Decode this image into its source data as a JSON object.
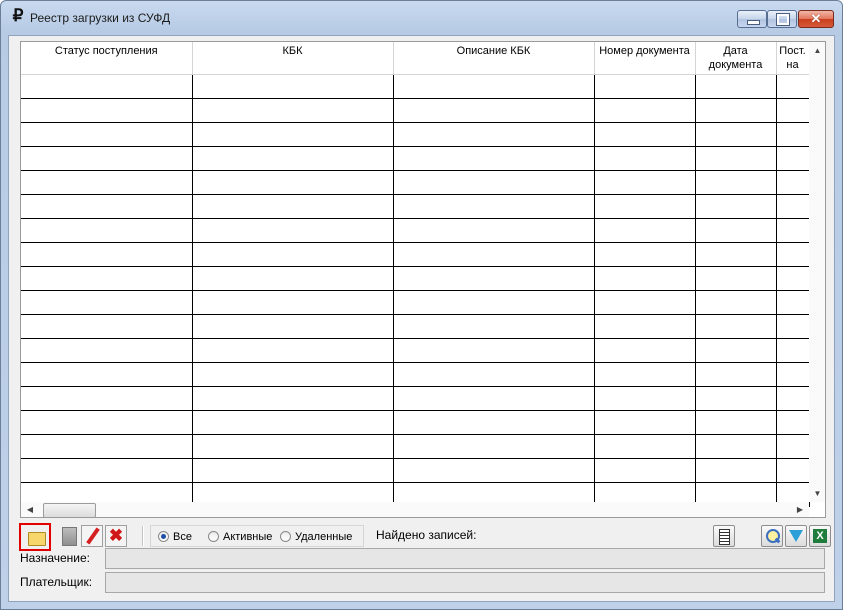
{
  "window": {
    "title": "Реестр загрузки из СУФД",
    "icon": "ruble-icon",
    "icon_glyph": "₽",
    "buttons": {
      "minimize": "minimize-icon",
      "maximize": "maximize-icon",
      "close_glyph": "✕"
    }
  },
  "grid": {
    "columns": [
      {
        "label": "Статус поступления"
      },
      {
        "label": "КБК"
      },
      {
        "label": "Описание КБК"
      },
      {
        "label": "Номер документа"
      },
      {
        "label": "Дата документа"
      },
      {
        "label": "Пост. на"
      }
    ],
    "row_count": 18
  },
  "toolbar": {
    "open_icon": "folder-open-icon",
    "stop_icon": "stop-icon",
    "edit_icon": "pencil-icon",
    "delete_icon": "delete-x-icon",
    "delete_glyph": "✖",
    "filter_options": [
      {
        "label": "Все",
        "checked": true
      },
      {
        "label": "Активные",
        "checked": false
      },
      {
        "label": "Удаленные",
        "checked": false
      }
    ],
    "found_label": "Найдено записей:",
    "columns_icon": "columns-icon",
    "search_icon": "magnifier-icon",
    "filter_icon": "filter-funnel-icon",
    "excel_icon": "excel-export-icon",
    "excel_glyph": "X"
  },
  "fields": {
    "purpose_label": "Назначение:",
    "purpose_value": "",
    "payer_label": "Плательщик:",
    "payer_value": ""
  },
  "colors": {
    "highlight_border": "#e00000",
    "title_gradient": "#c9daef",
    "close_button": "#d6593a"
  }
}
